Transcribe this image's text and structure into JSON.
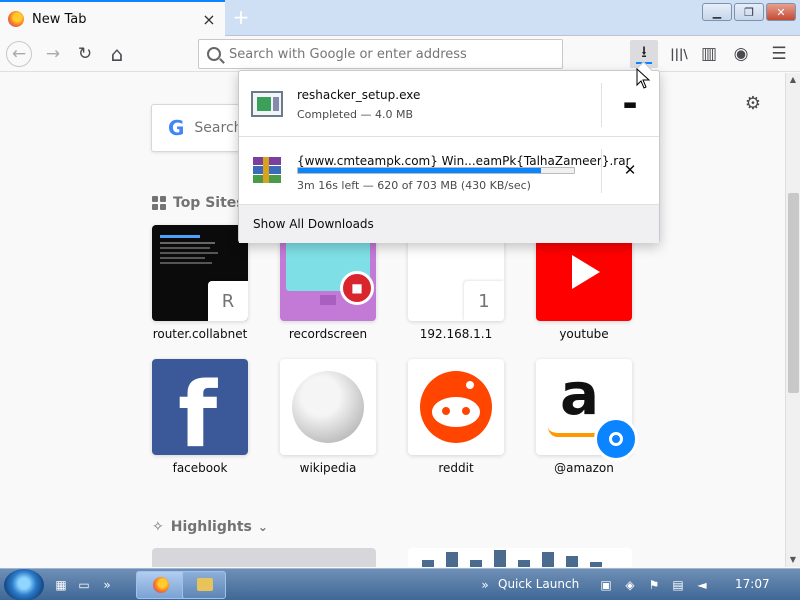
{
  "window": {
    "tab_title": "New Tab",
    "tab_close": "×",
    "new_tab": "+",
    "minimize": "▁",
    "maximize": "❐",
    "close": "✕"
  },
  "navbar": {
    "back": "←",
    "forward": "→",
    "reload": "↻",
    "home": "⌂",
    "url_placeholder": "Search with Google or enter address",
    "download": "⭳",
    "library": "|||\\",
    "sidebar": "▥",
    "account": "◉",
    "menu": "☰"
  },
  "newtab": {
    "search_placeholder": "Search",
    "google_logo": "G",
    "top_sites_title": "Top Sites",
    "highlights_title": "Highlights",
    "highlights_chevron": "⌄",
    "settings": "⚙",
    "top_sites": [
      {
        "label": "router.collabnet",
        "badge": "R",
        "bg": "#0b0b0b"
      },
      {
        "label": "recordscreen",
        "badge": "",
        "bg": "#c37ad6"
      },
      {
        "label": "192.168.1.1",
        "badge": "1",
        "bg": "#ffffff"
      },
      {
        "label": "youtube",
        "badge": "",
        "bg": "#ff0000"
      },
      {
        "label": "facebook",
        "badge": "",
        "bg": "#3b5998"
      },
      {
        "label": "wikipedia",
        "badge": "",
        "bg": "#ffffff"
      },
      {
        "label": "reddit",
        "badge": "",
        "bg": "#ff4500"
      },
      {
        "label": "@amazon",
        "badge": "",
        "bg": "#ffffff"
      }
    ]
  },
  "downloads": {
    "items": [
      {
        "filename": "reshacker_setup.exe",
        "status": "Completed — 4.0 MB",
        "action": "▬"
      },
      {
        "filename": "{www.cmteampk.com} Win...eamPk{TalhaZameer}.rar",
        "status": "3m 16s left — 620 of 703 MB (430 KB/sec)",
        "action": "✕",
        "progress": 0.88
      }
    ],
    "show_all": "Show All Downloads",
    "accent": "#0a84ff"
  },
  "taskbar": {
    "quick_launch": "Quick Launch",
    "clock": "17:07",
    "chevron": "»"
  }
}
